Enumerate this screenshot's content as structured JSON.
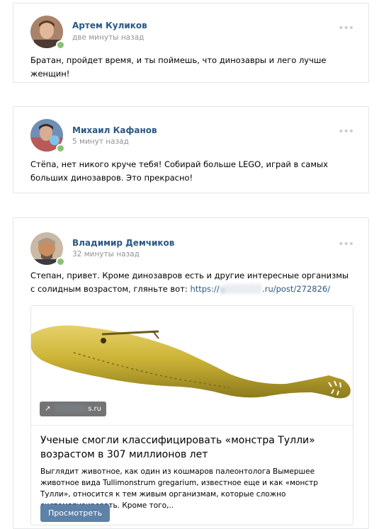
{
  "posts": [
    {
      "author": "Артем Куликов",
      "time": "две минуты назад",
      "text": "Братан, пройдет время, и ты поймешь, что динозавры и лего лучше женщин!",
      "menu": "•••"
    },
    {
      "author": "Михаил Кафанов",
      "time": "5 минут назад",
      "text": "Стёпа, нет никого круче тебя! Собирай больше LEGO, играй в самых больших динозавров. Это прекрасно!",
      "menu": "•••"
    },
    {
      "author": "Владимир Демчиков",
      "time": "32 минуты назад",
      "text_before_link": "Степан, привет. Кроме динозавров есть и другие интересные организмы с солидным возрастом, гляньте вот: ",
      "link": {
        "prefix": "https://",
        "blurred": "g░░░░░░",
        "suffix": ".ru/post/272826/"
      },
      "menu": "•••",
      "card": {
        "domain_blurred": "░░░░░░",
        "domain_suffix": "s.ru",
        "title": "Ученые смогли классифицировать «монстра Тулли» возрастом в 307 миллионов лет",
        "description": "Выглядит животное, как один из кошмаров палеонтолога Вымершее животное вида Tullimonstrum gregarium, известное еще и как «монстр Тулли», относится к тем живым организмам, которые сложно систематизировать. Кроме того,..",
        "button_label": "Просмотреть"
      }
    }
  ],
  "icons": {
    "link": "link-arrow-icon",
    "more": "more-dots-icon"
  },
  "colors": {
    "author": "#2a5885",
    "link": "#2a5885",
    "time": "#939393",
    "online": "#8ac176",
    "button": "#5e81a8"
  }
}
